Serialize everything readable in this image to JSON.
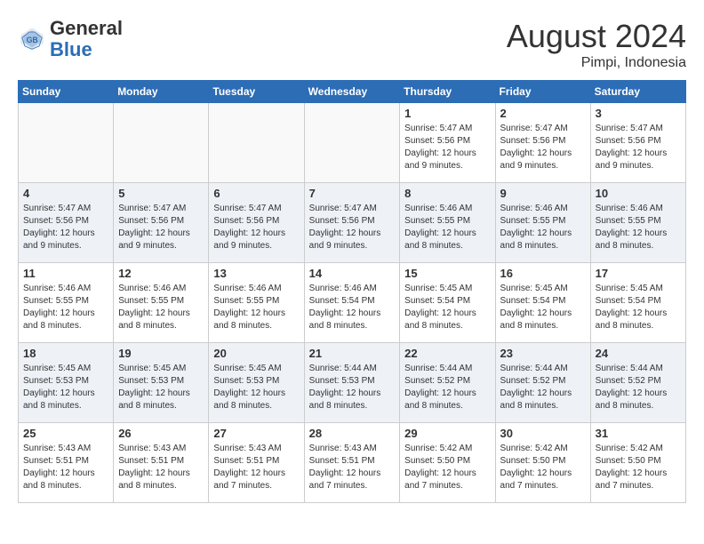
{
  "header": {
    "logo_general": "General",
    "logo_blue": "Blue",
    "month_title": "August 2024",
    "location": "Pimpi, Indonesia"
  },
  "weekdays": [
    "Sunday",
    "Monday",
    "Tuesday",
    "Wednesday",
    "Thursday",
    "Friday",
    "Saturday"
  ],
  "weeks": [
    [
      {
        "day": "",
        "info": ""
      },
      {
        "day": "",
        "info": ""
      },
      {
        "day": "",
        "info": ""
      },
      {
        "day": "",
        "info": ""
      },
      {
        "day": "1",
        "info": "Sunrise: 5:47 AM\nSunset: 5:56 PM\nDaylight: 12 hours\nand 9 minutes."
      },
      {
        "day": "2",
        "info": "Sunrise: 5:47 AM\nSunset: 5:56 PM\nDaylight: 12 hours\nand 9 minutes."
      },
      {
        "day": "3",
        "info": "Sunrise: 5:47 AM\nSunset: 5:56 PM\nDaylight: 12 hours\nand 9 minutes."
      }
    ],
    [
      {
        "day": "4",
        "info": "Sunrise: 5:47 AM\nSunset: 5:56 PM\nDaylight: 12 hours\nand 9 minutes."
      },
      {
        "day": "5",
        "info": "Sunrise: 5:47 AM\nSunset: 5:56 PM\nDaylight: 12 hours\nand 9 minutes."
      },
      {
        "day": "6",
        "info": "Sunrise: 5:47 AM\nSunset: 5:56 PM\nDaylight: 12 hours\nand 9 minutes."
      },
      {
        "day": "7",
        "info": "Sunrise: 5:47 AM\nSunset: 5:56 PM\nDaylight: 12 hours\nand 9 minutes."
      },
      {
        "day": "8",
        "info": "Sunrise: 5:46 AM\nSunset: 5:55 PM\nDaylight: 12 hours\nand 8 minutes."
      },
      {
        "day": "9",
        "info": "Sunrise: 5:46 AM\nSunset: 5:55 PM\nDaylight: 12 hours\nand 8 minutes."
      },
      {
        "day": "10",
        "info": "Sunrise: 5:46 AM\nSunset: 5:55 PM\nDaylight: 12 hours\nand 8 minutes."
      }
    ],
    [
      {
        "day": "11",
        "info": "Sunrise: 5:46 AM\nSunset: 5:55 PM\nDaylight: 12 hours\nand 8 minutes."
      },
      {
        "day": "12",
        "info": "Sunrise: 5:46 AM\nSunset: 5:55 PM\nDaylight: 12 hours\nand 8 minutes."
      },
      {
        "day": "13",
        "info": "Sunrise: 5:46 AM\nSunset: 5:55 PM\nDaylight: 12 hours\nand 8 minutes."
      },
      {
        "day": "14",
        "info": "Sunrise: 5:46 AM\nSunset: 5:54 PM\nDaylight: 12 hours\nand 8 minutes."
      },
      {
        "day": "15",
        "info": "Sunrise: 5:45 AM\nSunset: 5:54 PM\nDaylight: 12 hours\nand 8 minutes."
      },
      {
        "day": "16",
        "info": "Sunrise: 5:45 AM\nSunset: 5:54 PM\nDaylight: 12 hours\nand 8 minutes."
      },
      {
        "day": "17",
        "info": "Sunrise: 5:45 AM\nSunset: 5:54 PM\nDaylight: 12 hours\nand 8 minutes."
      }
    ],
    [
      {
        "day": "18",
        "info": "Sunrise: 5:45 AM\nSunset: 5:53 PM\nDaylight: 12 hours\nand 8 minutes."
      },
      {
        "day": "19",
        "info": "Sunrise: 5:45 AM\nSunset: 5:53 PM\nDaylight: 12 hours\nand 8 minutes."
      },
      {
        "day": "20",
        "info": "Sunrise: 5:45 AM\nSunset: 5:53 PM\nDaylight: 12 hours\nand 8 minutes."
      },
      {
        "day": "21",
        "info": "Sunrise: 5:44 AM\nSunset: 5:53 PM\nDaylight: 12 hours\nand 8 minutes."
      },
      {
        "day": "22",
        "info": "Sunrise: 5:44 AM\nSunset: 5:52 PM\nDaylight: 12 hours\nand 8 minutes."
      },
      {
        "day": "23",
        "info": "Sunrise: 5:44 AM\nSunset: 5:52 PM\nDaylight: 12 hours\nand 8 minutes."
      },
      {
        "day": "24",
        "info": "Sunrise: 5:44 AM\nSunset: 5:52 PM\nDaylight: 12 hours\nand 8 minutes."
      }
    ],
    [
      {
        "day": "25",
        "info": "Sunrise: 5:43 AM\nSunset: 5:51 PM\nDaylight: 12 hours\nand 8 minutes."
      },
      {
        "day": "26",
        "info": "Sunrise: 5:43 AM\nSunset: 5:51 PM\nDaylight: 12 hours\nand 8 minutes."
      },
      {
        "day": "27",
        "info": "Sunrise: 5:43 AM\nSunset: 5:51 PM\nDaylight: 12 hours\nand 7 minutes."
      },
      {
        "day": "28",
        "info": "Sunrise: 5:43 AM\nSunset: 5:51 PM\nDaylight: 12 hours\nand 7 minutes."
      },
      {
        "day": "29",
        "info": "Sunrise: 5:42 AM\nSunset: 5:50 PM\nDaylight: 12 hours\nand 7 minutes."
      },
      {
        "day": "30",
        "info": "Sunrise: 5:42 AM\nSunset: 5:50 PM\nDaylight: 12 hours\nand 7 minutes."
      },
      {
        "day": "31",
        "info": "Sunrise: 5:42 AM\nSunset: 5:50 PM\nDaylight: 12 hours\nand 7 minutes."
      }
    ]
  ]
}
